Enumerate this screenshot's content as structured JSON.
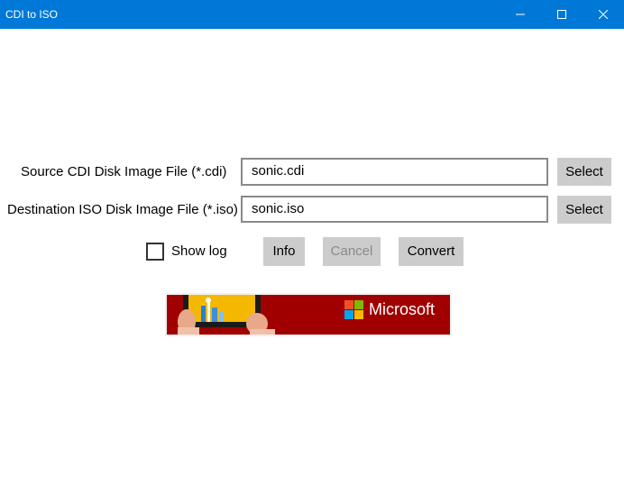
{
  "window": {
    "title": "CDI to ISO",
    "titlebar_color": "#0078d7"
  },
  "form": {
    "source_label": "Source CDI Disk Image File (*.cdi)",
    "source_value": "sonic.cdi",
    "source_select": "Select",
    "dest_label": "Destination ISO Disk Image File (*.iso)",
    "dest_value": "sonic.iso",
    "dest_select": "Select"
  },
  "actions": {
    "show_log_label": "Show log",
    "show_log_checked": false,
    "info": "Info",
    "cancel": "Cancel",
    "convert": "Convert"
  },
  "ad": {
    "brand": "Microsoft",
    "background_color": "#a00000"
  }
}
